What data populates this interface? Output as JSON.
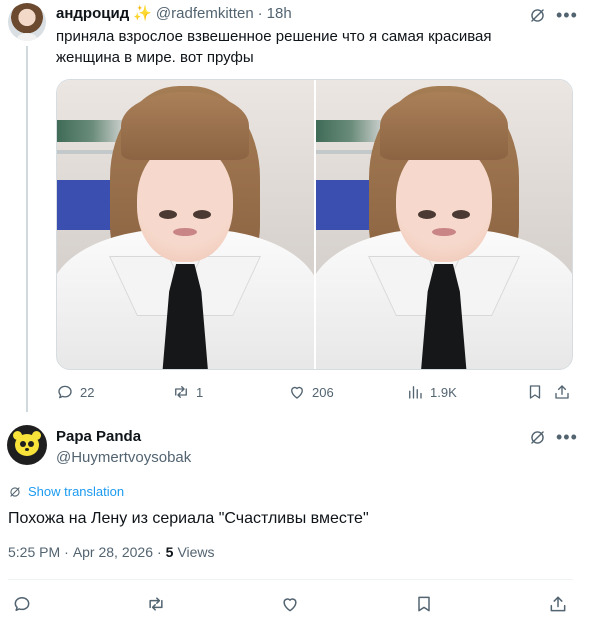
{
  "parent_tweet": {
    "display_name": "андроцид",
    "name_emoji": "✨",
    "handle": "@radfemkitten",
    "separator": "·",
    "time": "18h",
    "text": "приняла взрослое взвешенное решение что я самая красивая женщина в мире. вот пруфы",
    "actions": {
      "replies": "22",
      "reposts": "1",
      "likes": "206",
      "views": "1.9K"
    }
  },
  "reply_tweet": {
    "display_name": "Papa Panda",
    "handle": "@Huymertvoysobak",
    "translate_label": "Show translation",
    "text": "Похожа на Лену из сериала \"Счастливы вместе\"",
    "time": "5:25 PM",
    "date_separator": "·",
    "date": "Apr 28, 2026",
    "views_separator": "·",
    "views_count": "5",
    "views_label": "Views"
  },
  "icons": {
    "grok": "slashed-circle-icon",
    "more": "more-dots-icon",
    "reply": "reply-icon",
    "repost": "repost-icon",
    "like": "heart-icon",
    "views": "bar-chart-icon",
    "bookmark": "bookmark-icon",
    "share": "share-icon"
  },
  "colors": {
    "text": "#0f1419",
    "muted": "#536471",
    "link": "#1d9bf0",
    "border": "#cfd9de"
  }
}
